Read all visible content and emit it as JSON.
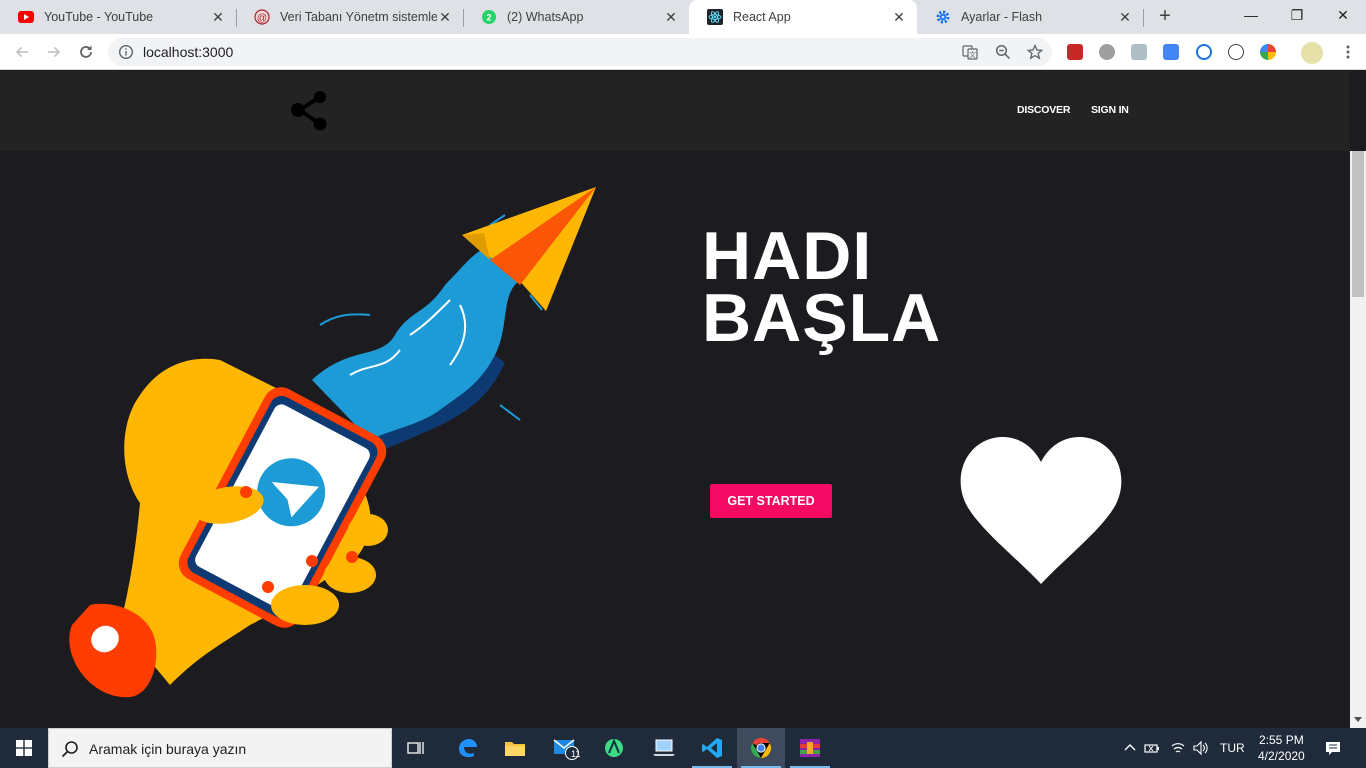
{
  "browser": {
    "tabs": [
      {
        "title": "YouTube - YouTube",
        "icon": "youtube-icon",
        "active": false
      },
      {
        "title": "Veri Tabanı Yönetm sistemleri I",
        "icon": "site-icon",
        "active": false
      },
      {
        "title": "(2) WhatsApp",
        "icon": "whatsapp-icon",
        "active": false
      },
      {
        "title": "React App",
        "icon": "react-icon",
        "active": true
      },
      {
        "title": "Ayarlar - Flash",
        "icon": "settings-gear-icon",
        "active": false
      }
    ],
    "close_glyph": "✕",
    "new_tab_glyph": "+",
    "window_controls": {
      "minimize": "—",
      "restore": "❐",
      "close": "✕"
    },
    "url": "localhost:3000"
  },
  "site": {
    "nav": {
      "discover": "DISCOVER",
      "sign_in": "SIGN IN"
    },
    "hero": {
      "line1": "HADI",
      "line2": "BAŞLA",
      "cta": "GET STARTED"
    },
    "colors": {
      "background": "#1c1b1f",
      "nav": "#232324",
      "accent": "#f50a63"
    }
  },
  "taskbar": {
    "search_placeholder": "Aramak için buraya yazın",
    "mail_badge": "11",
    "language": "TUR",
    "time": "2:55 PM",
    "date": "4/2/2020"
  }
}
